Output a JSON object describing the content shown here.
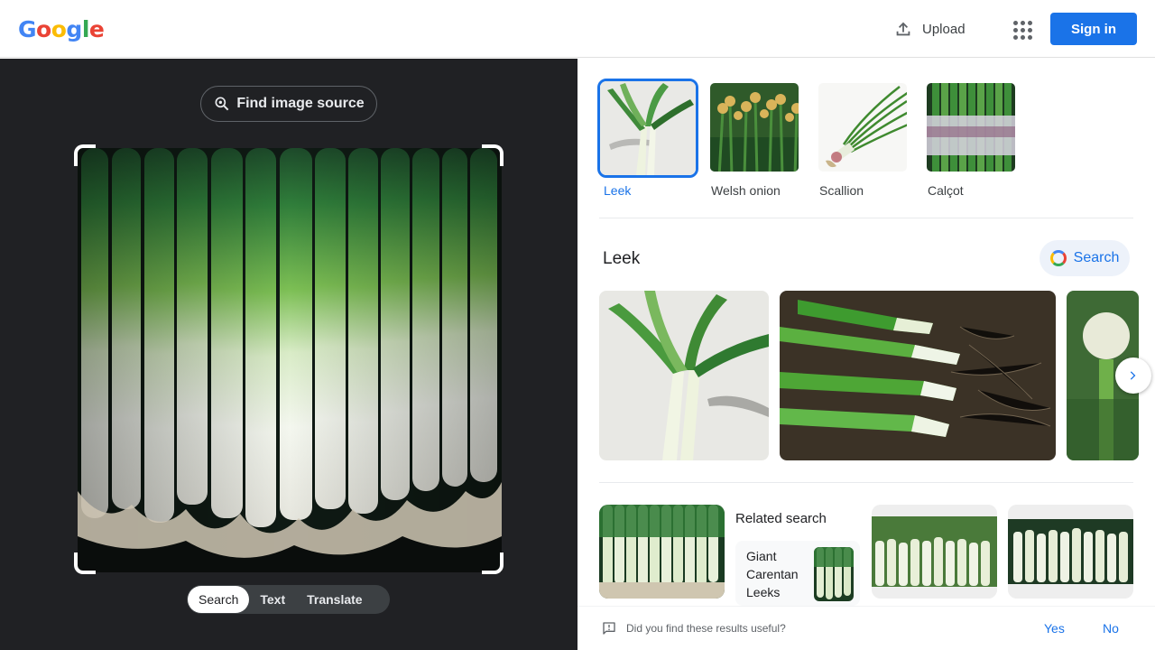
{
  "header": {
    "logo_letters": [
      "G",
      "o",
      "o",
      "g",
      "l",
      "e"
    ],
    "logo_colors": [
      "#4285F4",
      "#EA4335",
      "#FBBC05",
      "#4285F4",
      "#34A853",
      "#EA4335"
    ],
    "upload_label": "Upload",
    "upload_icon": "upload-icon",
    "apps_icon": "apps-grid-icon",
    "signin_label": "Sign in",
    "accent": "#1a73e8"
  },
  "left": {
    "find_source_label": "Find image source",
    "find_source_icon": "lens-search-icon",
    "image_subject": "leek bundle photo",
    "modes": [
      "Search",
      "Text",
      "Translate"
    ],
    "active_mode": "Search"
  },
  "right": {
    "chips": [
      {
        "label": "Leek",
        "active": true
      },
      {
        "label": "Welsh onion",
        "active": false
      },
      {
        "label": "Scallion",
        "active": false
      },
      {
        "label": "Calçot",
        "active": false
      }
    ],
    "knowledge_title": "Leek",
    "search_button_label": "Search",
    "next_icon": "chevron-right-icon",
    "related_label": "Related search",
    "related_card_lines": [
      "Giant",
      "Carentan",
      "Leeks"
    ],
    "feedback": {
      "question": "Did you find these results useful?",
      "yes": "Yes",
      "no": "No",
      "icon": "feedback-icon"
    }
  }
}
